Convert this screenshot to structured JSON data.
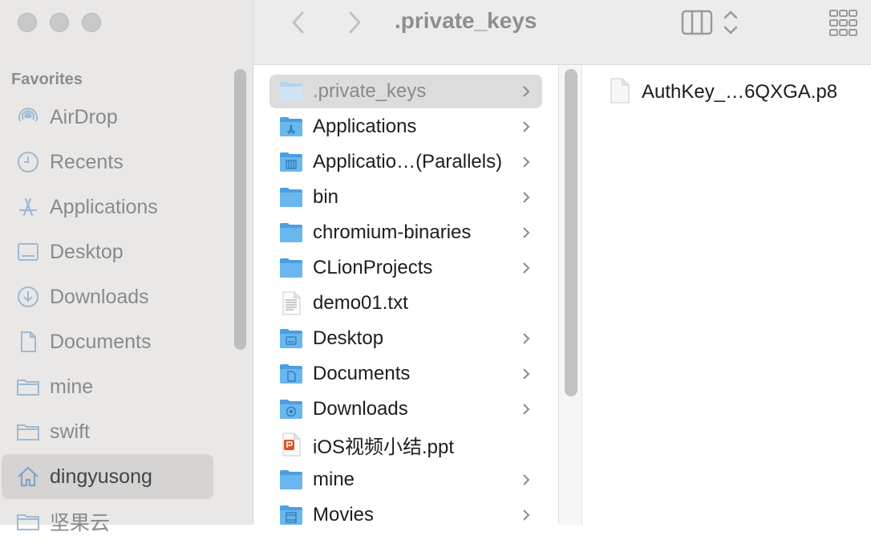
{
  "toolbar": {
    "title": ".private_keys",
    "back_icon": "chevron-left-icon",
    "forward_icon": "chevron-right-icon",
    "view_icon": "column-view-icon",
    "group_icon": "grid-view-icon"
  },
  "sidebar": {
    "section_title": "Favorites",
    "items": [
      {
        "label": "AirDrop",
        "icon": "airdrop-icon"
      },
      {
        "label": "Recents",
        "icon": "clock-icon"
      },
      {
        "label": "Applications",
        "icon": "applications-icon"
      },
      {
        "label": "Desktop",
        "icon": "desktop-icon"
      },
      {
        "label": "Downloads",
        "icon": "download-icon"
      },
      {
        "label": "Documents",
        "icon": "document-icon"
      },
      {
        "label": "mine",
        "icon": "folder-icon"
      },
      {
        "label": "swift",
        "icon": "folder-icon"
      },
      {
        "label": "dingyusong",
        "icon": "home-icon",
        "selected": true
      },
      {
        "label": "坚果云",
        "icon": "folder-icon"
      }
    ]
  },
  "column1": {
    "items": [
      {
        "name": ".private_keys",
        "type": "folder",
        "selected": true
      },
      {
        "name": "Applications",
        "type": "folder-apps"
      },
      {
        "name": "Applicatio…(Parallels)",
        "type": "folder-parallels"
      },
      {
        "name": "bin",
        "type": "folder"
      },
      {
        "name": "chromium-binaries",
        "type": "folder"
      },
      {
        "name": "CLionProjects",
        "type": "folder"
      },
      {
        "name": "demo01.txt",
        "type": "text-file"
      },
      {
        "name": "Desktop",
        "type": "folder-desktop"
      },
      {
        "name": "Documents",
        "type": "folder-documents"
      },
      {
        "name": "Downloads",
        "type": "folder-downloads"
      },
      {
        "name": "iOS视频小结.ppt",
        "type": "ppt-file"
      },
      {
        "name": "mine",
        "type": "folder"
      },
      {
        "name": "Movies",
        "type": "folder-movies"
      }
    ]
  },
  "column2": {
    "items": [
      {
        "name": "AuthKey_…6QXGA.p8",
        "type": "blank-file"
      }
    ]
  },
  "colors": {
    "folder": "#6ab7ef",
    "folder_dark": "#4a9fe0",
    "sidebar_bg": "#e9e8e7",
    "sidebar_icon": "#a5bfd6"
  }
}
